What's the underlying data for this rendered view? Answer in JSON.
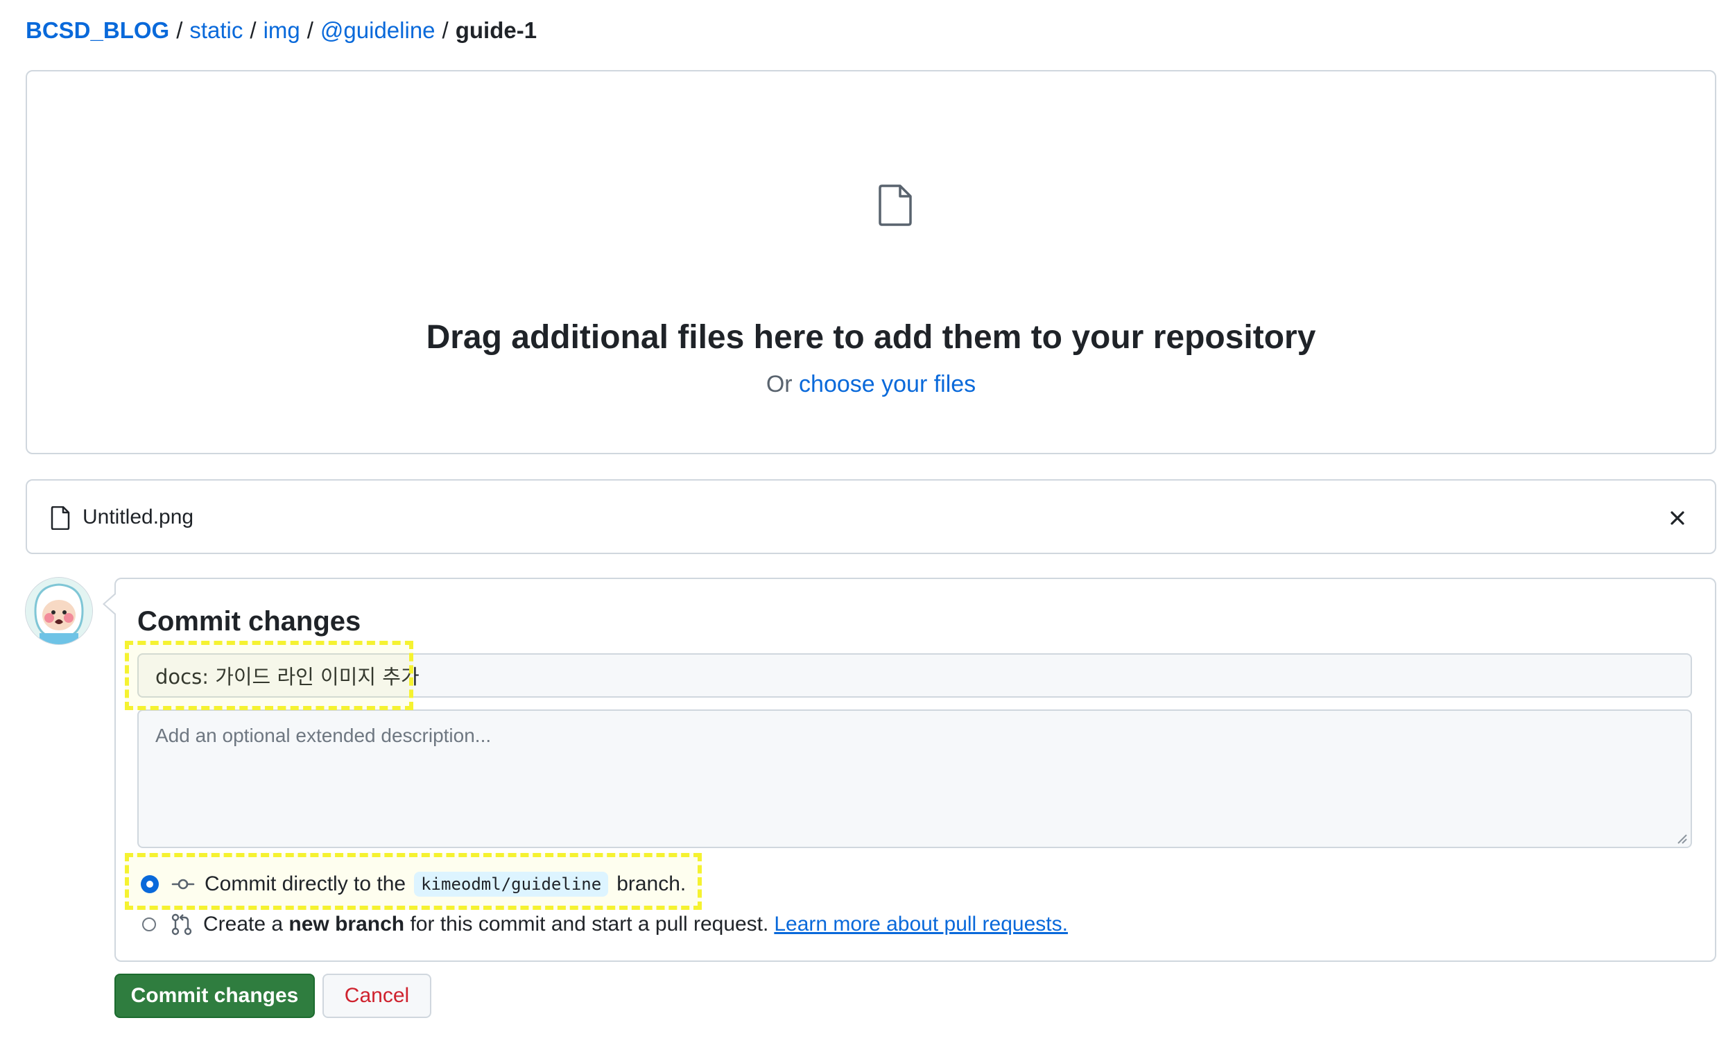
{
  "breadcrumb": {
    "root": "BCSD_BLOG",
    "items": [
      "static",
      "img",
      "@guideline"
    ],
    "current": "guide-1",
    "separator": "/"
  },
  "dropzone": {
    "icon": "file-icon",
    "title": "Drag additional files here to add them to your repository",
    "sub_prefix": "Or",
    "choose_link": "choose your files"
  },
  "file": {
    "icon": "file-icon",
    "name": "Untitled.png",
    "remove_icon": "close-icon"
  },
  "commit": {
    "title": "Commit changes",
    "summary_value": "docs: 가이드 라인 이미지 추가",
    "description_placeholder": "Add an optional extended description...",
    "option_direct": {
      "selected": true,
      "icon": "git-commit-icon",
      "prefix": "Commit directly to the",
      "branch": "kimeodml/guideline",
      "suffix": "branch."
    },
    "option_new": {
      "selected": false,
      "icon": "git-pull-request-icon",
      "prefix": "Create a",
      "bold": "new branch",
      "suffix": "for this commit and start a pull request.",
      "link": "Learn more about pull requests."
    }
  },
  "buttons": {
    "commit": "Commit changes",
    "cancel": "Cancel"
  },
  "colors": {
    "link": "#0969da",
    "primary_button": "#2f7d3f",
    "cancel_text": "#cf222e",
    "highlight": "#f5f230",
    "border": "#d0d7de"
  }
}
